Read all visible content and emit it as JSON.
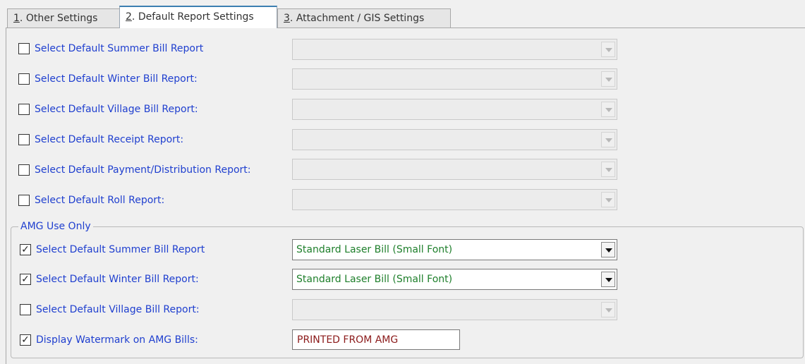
{
  "tabs": [
    {
      "key": "1",
      "label": ". Other Settings",
      "active": false
    },
    {
      "key": "2",
      "label": ". Default Report Settings",
      "active": true
    },
    {
      "key": "3",
      "label": ". Attachment / GIS Settings",
      "active": false
    }
  ],
  "default_reports": [
    {
      "label": "Select Default Summer Bill Report",
      "checked": false,
      "selected": ""
    },
    {
      "label": "Select Default Winter Bill Report:",
      "checked": false,
      "selected": ""
    },
    {
      "label": "Select Default Village Bill Report:",
      "checked": false,
      "selected": ""
    },
    {
      "label": "Select Default Receipt Report:",
      "checked": false,
      "selected": ""
    },
    {
      "label": "Select Default Payment/Distribution Report:",
      "checked": false,
      "selected": ""
    },
    {
      "label": "Select Default Roll Report:",
      "checked": false,
      "selected": ""
    }
  ],
  "amg": {
    "title": "AMG Use Only",
    "reports": [
      {
        "label": "Select Default Summer Bill Report",
        "checked": true,
        "selected": "Standard Laser Bill (Small Font)"
      },
      {
        "label": "Select Default Winter Bill Report:",
        "checked": true,
        "selected": "Standard Laser Bill (Small Font)"
      },
      {
        "label": "Select Default Village Bill Report:",
        "checked": false,
        "selected": ""
      }
    ],
    "watermark": {
      "label": "Display Watermark on AMG Bills:",
      "checked": true,
      "value": "PRINTED FROM AMG"
    }
  },
  "colors": {
    "label": "#1f3fcf",
    "combo_value": "#1e7f2b",
    "watermark_text": "#8b1a1a",
    "active_tab_accent": "#3c7fb1"
  },
  "icons": {
    "checkmark": "check-icon",
    "dropdown": "chevron-down-icon"
  }
}
